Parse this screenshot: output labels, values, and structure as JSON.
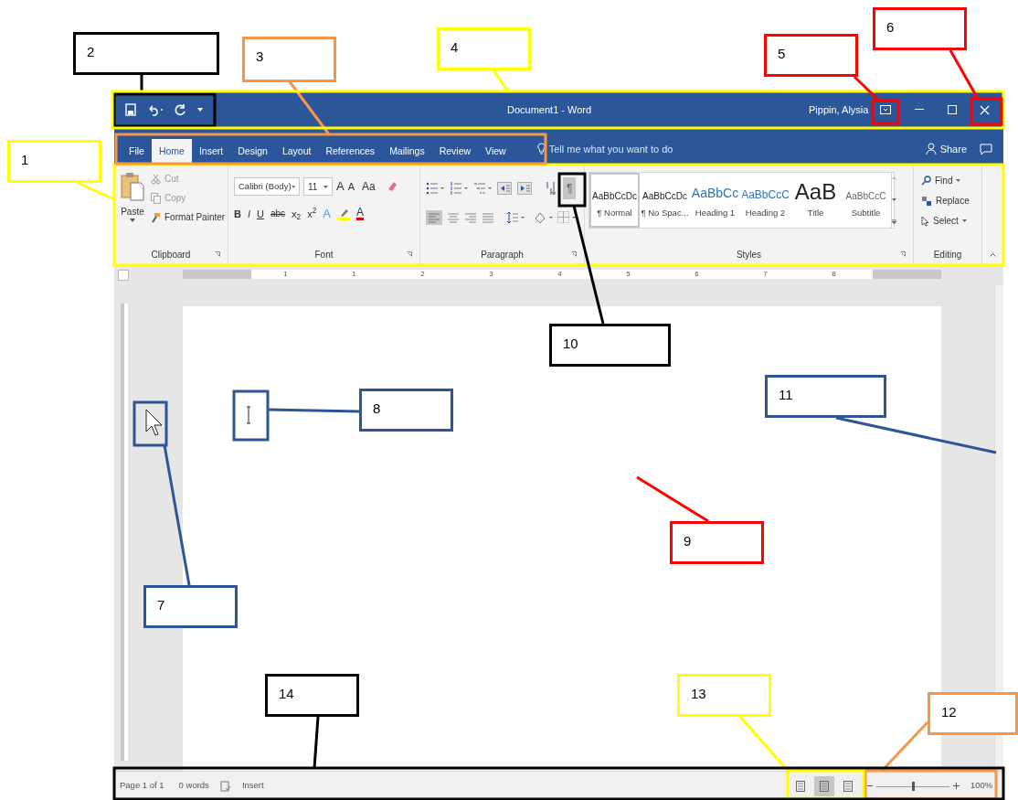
{
  "title_bar": {
    "document_title": "Document1 - Word",
    "user": "Pippin, Alysia"
  },
  "tabs": [
    {
      "label": "File",
      "selected": false
    },
    {
      "label": "Home",
      "selected": true
    },
    {
      "label": "Insert",
      "selected": false
    },
    {
      "label": "Design",
      "selected": false
    },
    {
      "label": "Layout",
      "selected": false
    },
    {
      "label": "References",
      "selected": false
    },
    {
      "label": "Mailings",
      "selected": false
    },
    {
      "label": "Review",
      "selected": false
    },
    {
      "label": "View",
      "selected": false
    }
  ],
  "tell_me": {
    "placeholder": "Tell me what you want to do"
  },
  "share": "Share",
  "ribbon": {
    "clipboard": {
      "paste": "Paste",
      "cut": "Cut",
      "copy": "Copy",
      "format_painter": "Format Painter",
      "group_label": "Clipboard"
    },
    "font": {
      "font_name": "Calibri (Body)",
      "font_size": "11",
      "size_tools": [
        "A",
        "A"
      ],
      "change_case": "Aa",
      "format_buttons": [
        {
          "label": "B",
          "kind": "bold"
        },
        {
          "label": "I",
          "kind": "italic"
        },
        {
          "label": "U",
          "kind": "underline"
        },
        {
          "label": "abc",
          "kind": "strike"
        },
        {
          "label": "x$_{2}$",
          "kind": "script"
        },
        {
          "label": "x$^{2}$",
          "kind": "script"
        },
        {
          "label": "A",
          "kind": "effects"
        },
        {
          "label": "A",
          "kind": "color"
        }
      ],
      "group_label": "Font"
    },
    "paragraph": {
      "sort_mark": "¶",
      "group_label": "Paragraph"
    },
    "styles": {
      "items": [
        {
          "preview": "AaBbCcDc",
          "name": "¶ Normal",
          "kind": "normal",
          "selected": true
        },
        {
          "preview": "AaBbCcDc",
          "name": "¶ No Spac...",
          "kind": "normal",
          "selected": false
        },
        {
          "preview": "AaBbCc",
          "name": "Heading 1",
          "kind": "heading1",
          "selected": false
        },
        {
          "preview": "AaBbCcC",
          "name": "Heading 2",
          "kind": "heading2",
          "selected": false
        },
        {
          "preview": "AaB",
          "name": "Title",
          "kind": "title",
          "selected": false
        },
        {
          "preview": "AaBbCcC",
          "name": "Subtitle",
          "kind": "subtitle",
          "selected": false
        }
      ],
      "group_label": "Styles"
    },
    "editing": {
      "find": "Find",
      "replace": "Replace",
      "select": "Select",
      "group_label": "Editing"
    }
  },
  "ruler": [
    "1",
    "1",
    "2",
    "3",
    "4",
    "5",
    "6",
    "7",
    "8"
  ],
  "status_bar": {
    "page": "Page 1 of 1",
    "words": "0 words",
    "mode": "Insert",
    "views": [
      {
        "selected": false
      },
      {
        "selected": true
      },
      {
        "selected": false
      }
    ],
    "zoom": {
      "level": 0.5,
      "reading": "100%"
    }
  },
  "callouts": [
    {
      "number": "1",
      "color": "#ffff00"
    },
    {
      "number": "2",
      "color": "#000000"
    },
    {
      "number": "3",
      "color": "#f79646"
    },
    {
      "number": "4",
      "color": "#ffff00"
    },
    {
      "number": "5",
      "color": "#ff0000"
    },
    {
      "number": "6",
      "color": "#ff0000"
    },
    {
      "number": "7",
      "color": "#2f5597"
    },
    {
      "number": "8",
      "color": "#2f5597"
    },
    {
      "number": "9",
      "color": "#ff0000"
    },
    {
      "number": "10",
      "color": "#000000"
    },
    {
      "number": "11",
      "color": "#2f5597"
    },
    {
      "number": "12",
      "color": "#f79646"
    },
    {
      "number": "13",
      "color": "#ffff00"
    },
    {
      "number": "14",
      "color": "#000000"
    }
  ]
}
